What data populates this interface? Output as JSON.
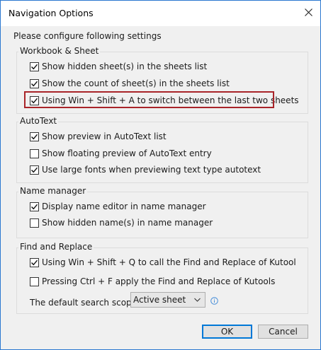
{
  "window": {
    "title": "Navigation Options"
  },
  "intro": "Please configure following settings",
  "groups": {
    "workbook": {
      "label": "Workbook & Sheet",
      "items": [
        {
          "label": "Show hidden sheet(s) in the sheets list",
          "checked": true
        },
        {
          "label": "Show the count of sheet(s) in the sheets list",
          "checked": true
        },
        {
          "label": "Using Win + Shift + A to switch between the last two sheets",
          "checked": true
        }
      ]
    },
    "autotext": {
      "label": "AutoText",
      "items": [
        {
          "label": "Show preview in AutoText list",
          "checked": true
        },
        {
          "label": "Show floating preview of AutoText entry",
          "checked": false
        },
        {
          "label": "Use large fonts when previewing text type autotext",
          "checked": true
        }
      ]
    },
    "namemanager": {
      "label": "Name manager",
      "items": [
        {
          "label": "Display name editor in name manager",
          "checked": true
        },
        {
          "label": "Show hidden name(s) in name manager",
          "checked": false
        }
      ]
    },
    "findreplace": {
      "label": "Find and Replace",
      "items": [
        {
          "label": "Using Win + Shift + Q to call the Find and Replace of Kutool",
          "checked": true
        },
        {
          "label": "Pressing Ctrl + F apply the Find and Replace of Kutools",
          "checked": false
        }
      ],
      "scope_label": "The default search scope:",
      "scope_value": "Active sheet"
    }
  },
  "buttons": {
    "ok": "OK",
    "cancel": "Cancel"
  },
  "icons": {
    "close": "close-icon",
    "check": "checkmark-icon",
    "dropdown": "chevron-down-icon",
    "info": "info-icon"
  },
  "colors": {
    "window_border": "#2b78d0",
    "highlight": "#a92429",
    "default_button": "#0078d7",
    "info_icon": "#4a90d9"
  }
}
